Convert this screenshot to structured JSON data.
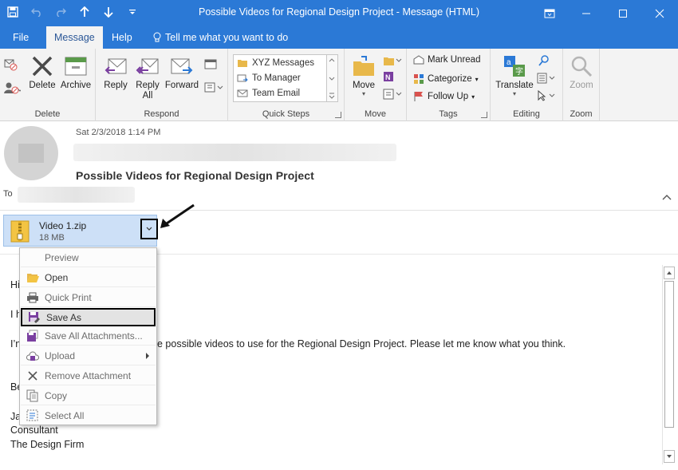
{
  "window": {
    "title": "Possible Videos for Regional Design Project  -  Message (HTML)"
  },
  "menu": {
    "file": "File",
    "message": "Message",
    "help": "Help",
    "tell_me": "Tell me what you want to do"
  },
  "ribbon": {
    "delete_group": {
      "label": "Delete",
      "delete": "Delete",
      "archive": "Archive"
    },
    "respond_group": {
      "label": "Respond",
      "reply": "Reply",
      "reply_all_1": "Reply",
      "reply_all_2": "All",
      "forward": "Forward"
    },
    "quick_steps_group": {
      "label": "Quick Steps",
      "items": [
        "XYZ Messages",
        "To Manager",
        "Team Email"
      ]
    },
    "move_group": {
      "label": "Move",
      "move": "Move"
    },
    "tags_group": {
      "label": "Tags",
      "mark_unread": "Mark Unread",
      "categorize": "Categorize",
      "follow_up": "Follow Up"
    },
    "editing_group": {
      "label": "Editing",
      "translate": "Translate"
    },
    "zoom_group": {
      "label": "Zoom",
      "zoom": "Zoom"
    }
  },
  "message": {
    "date": "Sat 2/3/2018 1:14 PM",
    "subject": "Possible Videos for Regional Design Project",
    "to_label": "To"
  },
  "attachment": {
    "name": "Video 1.zip",
    "size": "18 MB"
  },
  "context_menu": {
    "items": [
      {
        "label": "Preview",
        "icon": "none"
      },
      {
        "label": "Open",
        "icon": "folder-open-icon"
      },
      {
        "label": "Quick Print",
        "icon": "printer-icon"
      },
      {
        "label": "Save As",
        "icon": "save-as-icon"
      },
      {
        "label": "Save All Attachments...",
        "icon": "save-all-icon"
      },
      {
        "label": "Upload",
        "icon": "upload-icon"
      },
      {
        "label": "Remove Attachment",
        "icon": "remove-icon"
      },
      {
        "label": "Copy",
        "icon": "copy-icon"
      },
      {
        "label": "Select All",
        "icon": "select-all-icon"
      }
    ]
  },
  "body": {
    "line_hi": "Hi",
    "line_i": "I h",
    "line_videos_start": "I’n",
    "line_videos_rest": "e possible videos to use for the Regional Design Project. Please let me know what you think.",
    "line_best": "Be",
    "line_name": "Ja",
    "line_title": "Consultant",
    "line_company": "The Design Firm"
  },
  "colors": {
    "accent": "#2b79d6",
    "ribbon_bg": "#f3f3f3",
    "attachment_bg": "#cde0f7",
    "purple_icon": "#7a3fa0"
  }
}
